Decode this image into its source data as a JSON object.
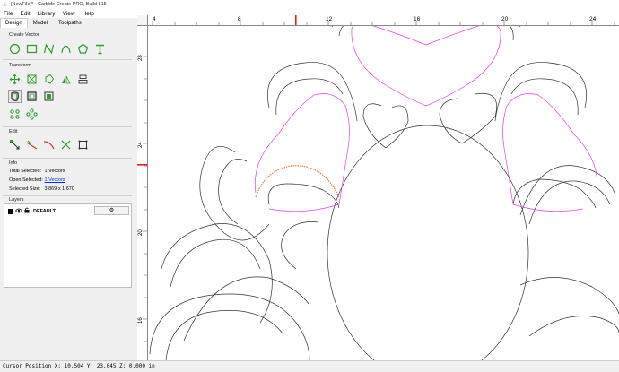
{
  "window": {
    "title": "[NewFile]* - Carbide Create PRO, Build 815"
  },
  "menu": [
    "File",
    "Edit",
    "Library",
    "View",
    "Help"
  ],
  "tabs": [
    "Design",
    "Model",
    "Toolpaths"
  ],
  "sections": {
    "create_vector": "Create Vector",
    "transform": "Transform",
    "edit": "Edit",
    "info": "Info",
    "layers": "Layers"
  },
  "info": {
    "total_selected_label": "Total Selected:",
    "total_selected_value": "1 Vectors",
    "open_selected_label": "Open Selected:",
    "open_selected_value": "1 Vectors",
    "selected_size_label": "Selected Size:",
    "selected_size_value": "3.869 x 1.670"
  },
  "layers": {
    "items": [
      {
        "name": "DEFAULT",
        "color": "#000000"
      }
    ],
    "settings_icon": "gear-icon"
  },
  "ruler": {
    "x_labels": [
      "4",
      "8",
      "12",
      "16",
      "20",
      "24"
    ],
    "y_labels": [
      "28",
      "24",
      "20",
      "16"
    ]
  },
  "status": {
    "cursor": "Cursor Position X: 10.504 Y: 23.045 Z: 0.000 in"
  },
  "colors": {
    "vector": "#333333",
    "offset": "#e040e0",
    "selected": "#e08040",
    "accent": "#2e9b2e",
    "cursor_marker": "#e02020"
  }
}
